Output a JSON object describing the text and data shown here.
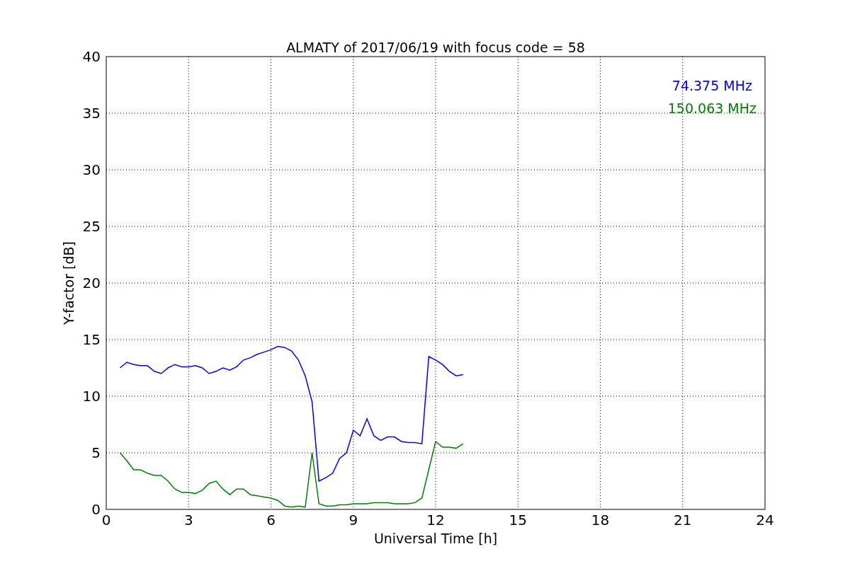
{
  "chart_data": {
    "type": "line",
    "title": "ALMATY of 2017/06/19 with focus code = 58",
    "xlabel": "Universal Time [h]",
    "ylabel": "Y-factor [dB]",
    "x": [
      0.5,
      0.75,
      1,
      1.25,
      1.5,
      1.75,
      2,
      2.25,
      2.5,
      2.75,
      3,
      3.25,
      3.5,
      3.75,
      4,
      4.25,
      4.5,
      4.75,
      5,
      5.25,
      5.5,
      5.75,
      6,
      6.25,
      6.5,
      6.75,
      7,
      7.25,
      7.5,
      7.75,
      8,
      8.25,
      8.5,
      8.75,
      9,
      9.25,
      9.5,
      9.75,
      10,
      10.25,
      10.5,
      10.75,
      11,
      11.25,
      11.5,
      11.75,
      12,
      12.25,
      12.5,
      12.75,
      13
    ],
    "series": [
      {
        "name": "74.375 MHz",
        "color": "#0000ff",
        "values": [
          12.5,
          13,
          12.8,
          12.7,
          12.7,
          12.2,
          12,
          12.5,
          12.8,
          12.6,
          12.6,
          12.7,
          12.5,
          12,
          12.2,
          12.5,
          12.3,
          12.6,
          13.2,
          13.4,
          13.7,
          13.9,
          14.1,
          14.4,
          14.3,
          14,
          13.2,
          11.8,
          9.5,
          2.5,
          2.8,
          3.2,
          4.5,
          5,
          7,
          6.5,
          8,
          6.5,
          6.1,
          6.4,
          6.4,
          6,
          5.9,
          5.9,
          5.8,
          13.5,
          13.2,
          12.8,
          12.2,
          11.8,
          11.9
        ]
      },
      {
        "name": "150.063 MHz",
        "color": "#008000",
        "values": [
          5,
          4.3,
          3.5,
          3.5,
          3.2,
          3,
          3,
          2.5,
          1.8,
          1.5,
          1.5,
          1.4,
          1.7,
          2.3,
          2.5,
          1.8,
          1.3,
          1.8,
          1.8,
          1.3,
          1.2,
          1.1,
          1,
          0.8,
          0.3,
          0.2,
          0.3,
          0.2,
          5,
          0.5,
          0.3,
          0.3,
          0.4,
          0.4,
          0.5,
          0.5,
          0.5,
          0.6,
          0.6,
          0.6,
          0.5,
          0.5,
          0.5,
          0.6,
          1,
          3.5,
          6,
          5.5,
          5.5,
          5.4,
          5.8
        ]
      }
    ],
    "xlim": [
      0,
      24
    ],
    "ylim": [
      0,
      40
    ],
    "xticks": [
      0,
      3,
      6,
      9,
      12,
      15,
      18,
      21,
      24
    ],
    "yticks": [
      0,
      5,
      10,
      15,
      20,
      25,
      30,
      35,
      40
    ],
    "grid": true
  }
}
